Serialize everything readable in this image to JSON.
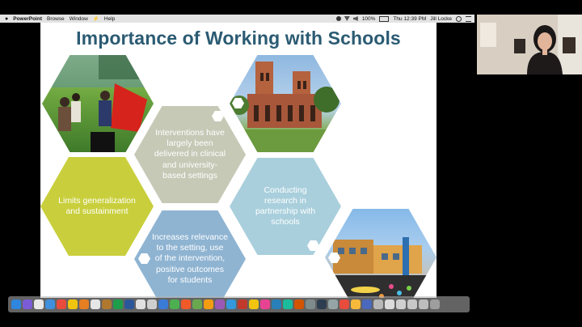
{
  "menubar": {
    "app_name": "PowerPoint",
    "items": [
      "Browse",
      "Window",
      "Help"
    ],
    "battery": "100%",
    "clock": "Thu 12:39 PM",
    "user": "Jill Locke"
  },
  "slide": {
    "title": "Importance of Working with Schools",
    "hexagons": [
      {
        "text": "Interventions have largely been delivered in clinical and university-based settings",
        "color": "#c6c9b6"
      },
      {
        "text": "Limits generalization and sustainment",
        "color": "#c9cf3c"
      },
      {
        "text": "Conducting research in partnership with schools",
        "color": "#a9cfdc"
      },
      {
        "text": "Increases relevance to the setting, use of the intervention, positive outcomes for students",
        "color": "#8fb4d2"
      }
    ],
    "photos": [
      {
        "name": "children-playing-photo"
      },
      {
        "name": "university-building-photo"
      },
      {
        "name": "school-courtyard-photo"
      }
    ]
  },
  "dock": {
    "icon_colors": [
      "#2e86de",
      "#7b5cd6",
      "#e8e8e8",
      "#3f8fdd",
      "#e84c3d",
      "#f1c40f",
      "#e67e22",
      "#e6e6e6",
      "#b0782f",
      "#1e9e4a",
      "#2b579a",
      "#e0e0e0",
      "#cfcfcf",
      "#3a7bd5",
      "#4caf50",
      "#f05a28",
      "#6aa84f",
      "#f39c12",
      "#9b59b6",
      "#3498db",
      "#c0392b",
      "#f1c40f",
      "#e84393",
      "#2980b9",
      "#1abc9c",
      "#d35400",
      "#7f8c8d",
      "#2c3e50",
      "#95a5a6",
      "#e74c3c",
      "#f6b93b",
      "#4a69bd",
      "#b8b8b8",
      "#dcdcdc",
      "#d0d0d0",
      "#c8c8c8",
      "#bdbdbd",
      "#9e9e9e"
    ]
  }
}
